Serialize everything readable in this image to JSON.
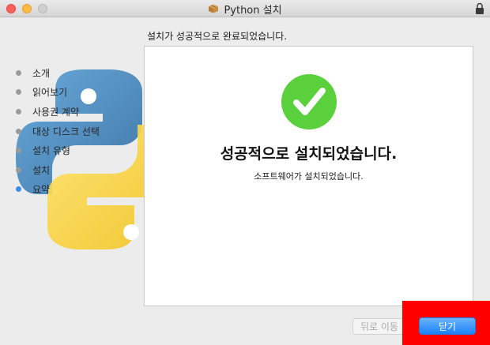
{
  "window": {
    "title": "Python 설치",
    "title_icon": "package-icon",
    "lock_icon": "lock-icon"
  },
  "heading": "설치가 성공적으로 완료되었습니다.",
  "steps": [
    {
      "label": "소개",
      "active": false
    },
    {
      "label": "읽어보기",
      "active": false
    },
    {
      "label": "사용권 계약",
      "active": false
    },
    {
      "label": "대상 디스크 선택",
      "active": false
    },
    {
      "label": "설치 유형",
      "active": false
    },
    {
      "label": "설치",
      "active": false
    },
    {
      "label": "요약",
      "active": true
    }
  ],
  "panel": {
    "success_title": "성공적으로 설치되었습니다.",
    "success_subtitle": "소프트웨어가 설치되었습니다.",
    "icon": "checkmark-circle-icon"
  },
  "buttons": {
    "back_label": "뒤로 이동",
    "close_label": "닫기"
  },
  "colors": {
    "accent_blue": "#1a82fb",
    "success_green": "#5ad13c",
    "highlight_red": "#ff0000"
  }
}
